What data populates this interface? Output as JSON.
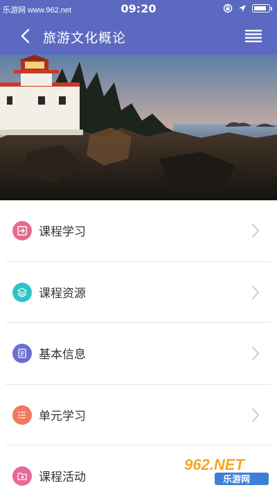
{
  "status_bar": {
    "watermark": "乐游网 www.962.net",
    "time": "09:20",
    "icons": [
      "rotation-lock-icon",
      "location-icon",
      "battery-icon"
    ]
  },
  "nav": {
    "title": "旅游文化概论",
    "back_icon": "chevron-left-icon",
    "menu_icon": "hamburger-menu-icon",
    "color": "#5b6ac0"
  },
  "banner": {
    "image": "lighthouse-on-rocky-coast-at-sunset"
  },
  "menu_items": [
    {
      "label": "课程学习",
      "icon": "login-arrow-icon",
      "color": "#e96a8e"
    },
    {
      "label": "课程资源",
      "icon": "layers-icon",
      "color": "#2ec3c9"
    },
    {
      "label": "基本信息",
      "icon": "document-icon",
      "color": "#6a6fd0"
    },
    {
      "label": "单元学习",
      "icon": "list-icon",
      "color": "#ef7a5e"
    },
    {
      "label": "课程活动",
      "icon": "folder-icon",
      "color": "#e9679a"
    }
  ],
  "watermark_logo": {
    "text": "962.NET",
    "subtext": "乐游网"
  }
}
